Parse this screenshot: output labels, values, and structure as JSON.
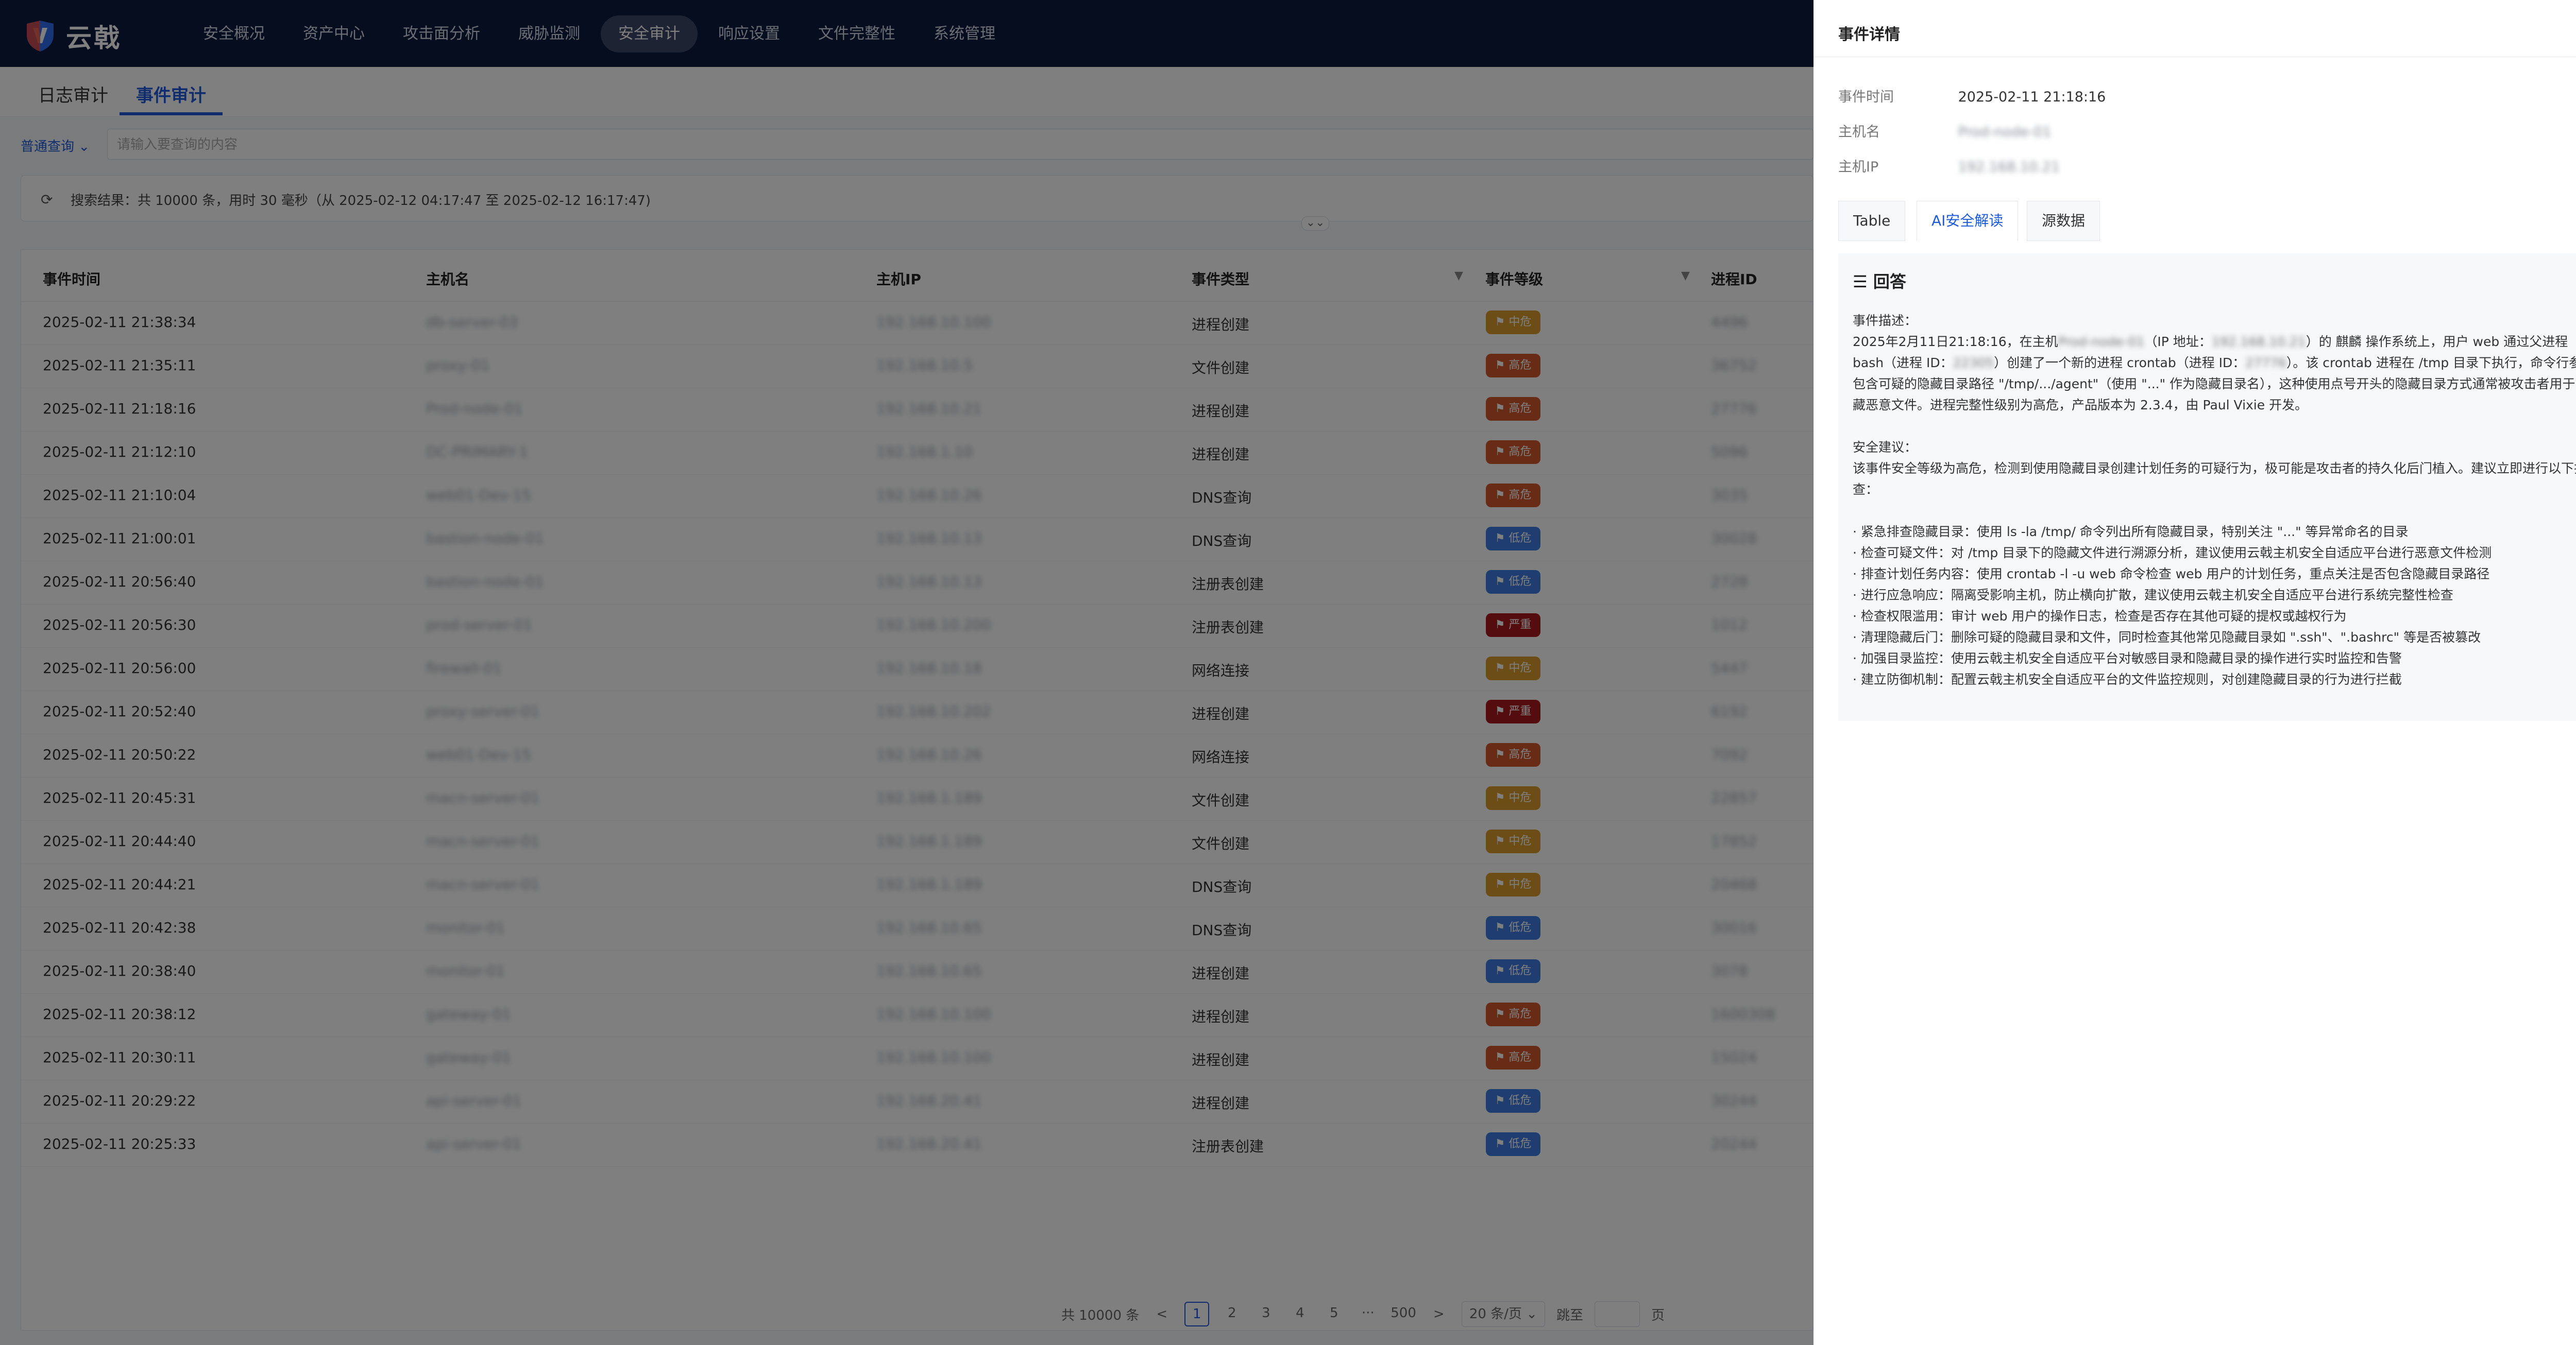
{
  "nav": {
    "logo": "云戟",
    "items": [
      "安全概况",
      "资产中心",
      "攻击面分析",
      "威胁监测",
      "安全审计",
      "响应设置",
      "文件完整性",
      "系统管理"
    ],
    "active_index": 4
  },
  "tabs": [
    "日志审计",
    "事件审计"
  ],
  "search": {
    "mode": "普通查询",
    "placeholder": "请输入要查询的内容",
    "result": "搜索结果：共 10000 条，用时 30 毫秒（从 2025-02-12 04:17:47 至 2025-02-12 16:17:47)"
  },
  "table": {
    "columns": [
      "事件时间",
      "主机名",
      "主机IP",
      "事件类型",
      "事件等级",
      "进程ID"
    ],
    "rows": [
      {
        "time": "2025-02-11 21:38:34",
        "host": "db-server-03",
        "ip": "192.168.10.100",
        "type": "进程创建",
        "level": "中危",
        "pid": "4496"
      },
      {
        "time": "2025-02-11 21:35:11",
        "host": "proxy-01",
        "ip": "192.168.10.5",
        "type": "文件创建",
        "level": "高危",
        "pid": "36752"
      },
      {
        "time": "2025-02-11 21:18:16",
        "host": "Prod-node-01",
        "ip": "192.168.10.21",
        "type": "进程创建",
        "level": "高危",
        "pid": "27776"
      },
      {
        "time": "2025-02-11 21:12:10",
        "host": "DC-PRIMARY-1",
        "ip": "192.168.1.10",
        "type": "进程创建",
        "level": "高危",
        "pid": "5096"
      },
      {
        "time": "2025-02-11 21:10:04",
        "host": "web01-Dev-15",
        "ip": "192.168.10.26",
        "type": "DNS查询",
        "level": "高危",
        "pid": "3035"
      },
      {
        "time": "2025-02-11 21:00:01",
        "host": "bastion-node-01",
        "ip": "192.168.10.13",
        "type": "DNS查询",
        "level": "低危",
        "pid": "30028"
      },
      {
        "time": "2025-02-11 20:56:40",
        "host": "bastion-node-01",
        "ip": "192.168.10.13",
        "type": "注册表创建",
        "level": "低危",
        "pid": "2728"
      },
      {
        "time": "2025-02-11 20:56:30",
        "host": "prod-server-01",
        "ip": "192.168.10.200",
        "type": "注册表创建",
        "level": "严重",
        "pid": "1012"
      },
      {
        "time": "2025-02-11 20:56:00",
        "host": "firewall-01",
        "ip": "192.168.10.18",
        "type": "网络连接",
        "level": "中危",
        "pid": "5447"
      },
      {
        "time": "2025-02-11 20:52:40",
        "host": "proxy-server-01",
        "ip": "192.168.10.202",
        "type": "进程创建",
        "level": "严重",
        "pid": "6192"
      },
      {
        "time": "2025-02-11 20:50:22",
        "host": "web01-Dev-15",
        "ip": "192.168.10.26",
        "type": "网络连接",
        "level": "高危",
        "pid": "7092"
      },
      {
        "time": "2025-02-11 20:45:31",
        "host": "macn-server-01",
        "ip": "192.168.1.189",
        "type": "文件创建",
        "level": "中危",
        "pid": "22857"
      },
      {
        "time": "2025-02-11 20:44:40",
        "host": "macn-server-01",
        "ip": "192.168.1.189",
        "type": "文件创建",
        "level": "中危",
        "pid": "17852"
      },
      {
        "time": "2025-02-11 20:44:21",
        "host": "macn-server-01",
        "ip": "192.168.1.189",
        "type": "DNS查询",
        "level": "中危",
        "pid": "20468"
      },
      {
        "time": "2025-02-11 20:42:38",
        "host": "monitor-01",
        "ip": "192.168.10.65",
        "type": "DNS查询",
        "level": "低危",
        "pid": "30016"
      },
      {
        "time": "2025-02-11 20:38:40",
        "host": "monitor-01",
        "ip": "192.168.10.65",
        "type": "进程创建",
        "level": "低危",
        "pid": "3078"
      },
      {
        "time": "2025-02-11 20:38:12",
        "host": "gateway-01",
        "ip": "192.168.10.100",
        "type": "进程创建",
        "level": "高危",
        "pid": "1600308"
      },
      {
        "time": "2025-02-11 20:30:11",
        "host": "gateway-01",
        "ip": "192.168.10.100",
        "type": "进程创建",
        "level": "高危",
        "pid": "15024"
      },
      {
        "time": "2025-02-11 20:29:22",
        "host": "api-server-01",
        "ip": "192.168.20.41",
        "type": "进程创建",
        "level": "低危",
        "pid": "30244"
      },
      {
        "time": "2025-02-11 20:25:33",
        "host": "api-server-01",
        "ip": "192.168.20.41",
        "type": "注册表创建",
        "level": "低危",
        "pid": "20244"
      }
    ]
  },
  "level_colors": {
    "中危": "#d89a2a",
    "高危": "#d0562a",
    "低危": "#3f7be0",
    "严重": "#a8191c"
  },
  "pagination": {
    "total": "共 10000 条",
    "prev": "<",
    "pages": [
      "1",
      "2",
      "3",
      "4",
      "5",
      "···",
      "500"
    ],
    "current": "1",
    "next": ">",
    "page_size": "20 条/页",
    "jump_label": "跳至",
    "page_unit": "页"
  },
  "drawer": {
    "title": "事件详情",
    "fields": {
      "time_label": "事件时间",
      "time_value": "2025-02-11 21:18:16",
      "host_label": "主机名",
      "host_value": "Prod-node-01",
      "ip_label": "主机IP",
      "ip_value": "192.168.10.21"
    },
    "tabs": [
      "Table",
      "AI安全解读",
      "源数据"
    ],
    "active_tab": "AI安全解读",
    "answer": {
      "heading": "回答",
      "desc_title": "事件描述：",
      "desc_1": "2025年2月11日21:18:16，在主机",
      "host_masked": "Prod-node-01",
      "desc_2": "（IP 地址：",
      "ip_masked": "192.168.10.21",
      "desc_3": "）的 麒麟 操作系统上，用户 web 通过父进程 bash（进程 ID：",
      "ppid_masked": "22305",
      "desc_4": "）创建了一个新的进程 crontab（进程 ID：",
      "pid_masked": "27776",
      "desc_5": "）。该 crontab 进程在 /tmp 目录下执行，命令行参数包含可疑的隐藏目录路径 \"/tmp/.../agent\"（使用 \"...\" 作为隐藏目录名），这种使用点号开头的隐藏目录方式通常被攻击者用于隐藏恶意文件。进程完整性级别为高危，产品版本为 2.3.4，由 Paul Vixie 开发。",
      "advice_title": "安全建议：",
      "advice_intro": "该事件安全等级为高危，检测到使用隐藏目录创建计划任务的可疑行为，极可能是攻击者的持久化后门植入。建议立即进行以下排查：",
      "bullets": [
        "· 紧急排查隐藏目录：使用 ls -la /tmp/ 命令列出所有隐藏目录，特别关注 \"...\" 等异常命名的目录",
        "· 检查可疑文件：对 /tmp 目录下的隐藏文件进行溯源分析，建议使用云戟主机安全自适应平台进行恶意文件检测",
        "· 排查计划任务内容：使用 crontab -l -u web 命令检查 web 用户的计划任务，重点关注是否包含隐藏目录路径",
        "· 进行应急响应：隔离受影响主机，防止横向扩散，建议使用云戟主机安全自适应平台进行系统完整性检查",
        "· 检查权限滥用：审计 web 用户的操作日志，检查是否存在其他可疑的提权或越权行为",
        "· 清理隐藏后门：删除可疑的隐藏目录和文件，同时检查其他常见隐藏目录如 \".ssh\"、\".bashrc\" 等是否被篡改",
        "· 加强目录监控：使用云戟主机安全自适应平台对敏感目录和隐藏目录的操作进行实时监控和告警",
        "· 建立防御机制：配置云戟主机安全自适应平台的文件监控规则，对创建隐藏目录的行为进行拦截"
      ]
    }
  }
}
